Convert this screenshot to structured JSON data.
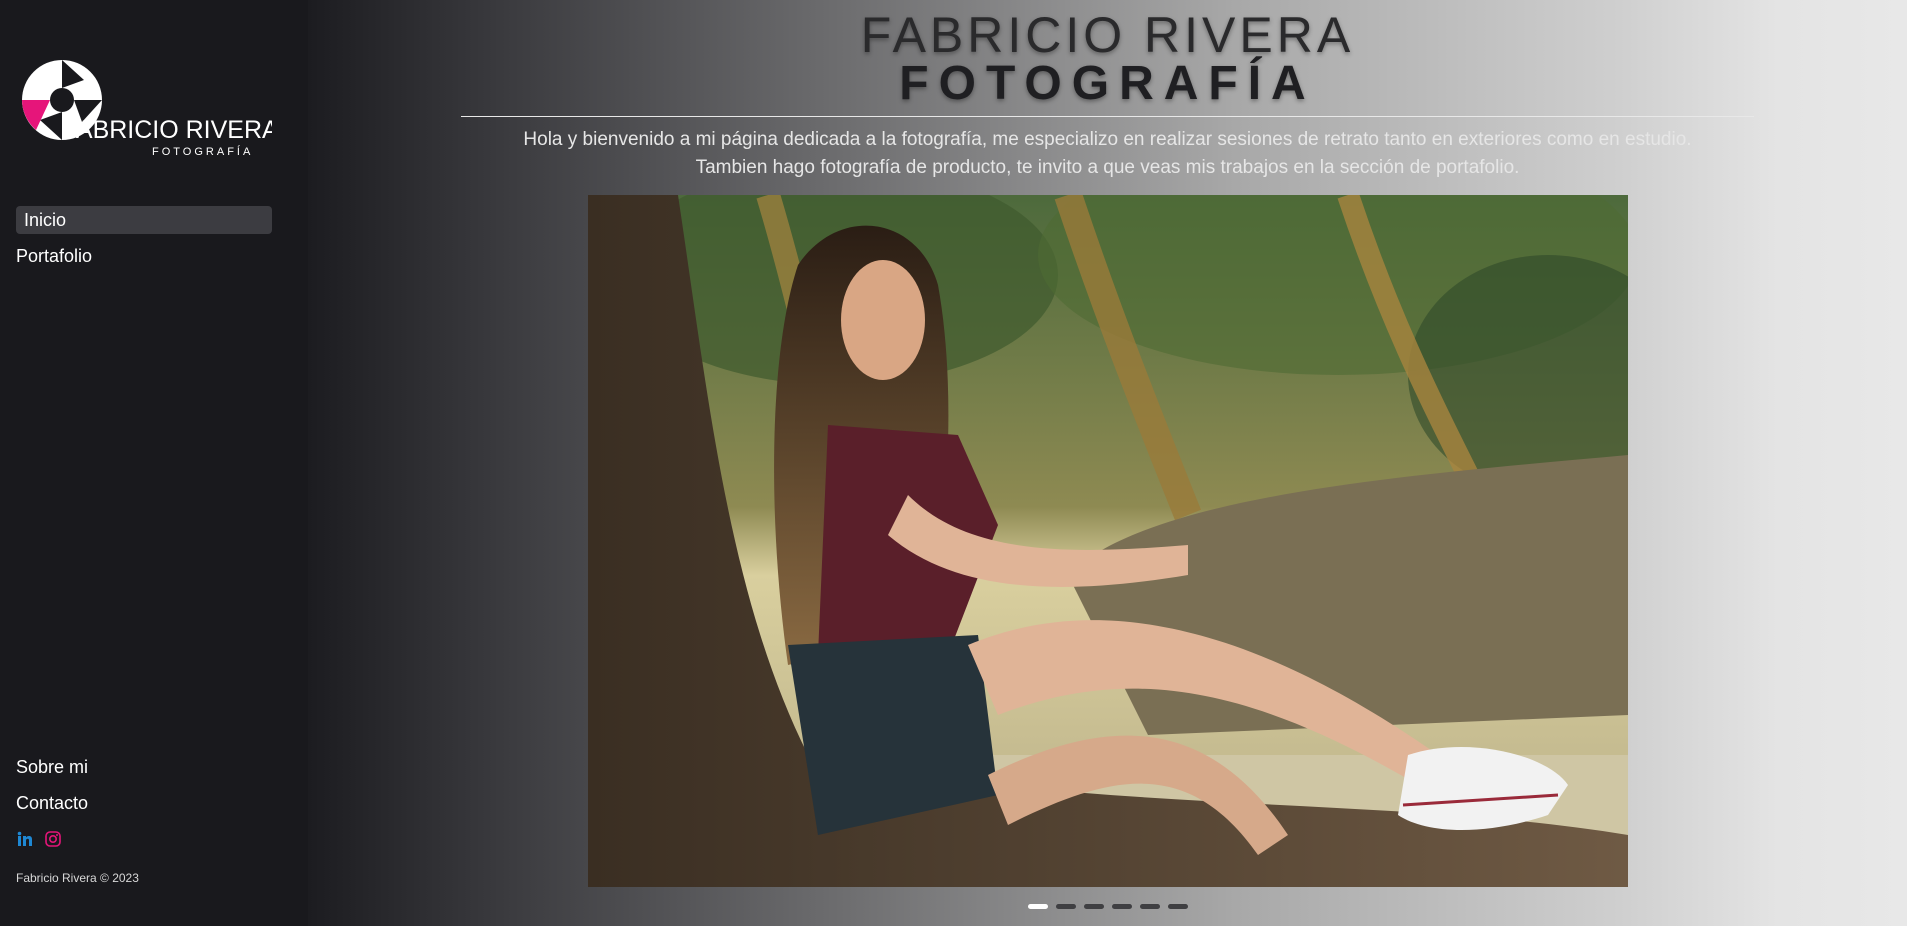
{
  "brand": {
    "name": "FABRICIO RIVERA",
    "tagline": "FOTOGRAFÍA",
    "accent": "#e6157a"
  },
  "sidebar": {
    "nav": [
      {
        "label": "Inicio",
        "active": true
      },
      {
        "label": "Portafolio",
        "active": false
      }
    ],
    "bottom_nav": [
      {
        "label": "Sobre mi"
      },
      {
        "label": "Contacto"
      }
    ],
    "social": [
      {
        "icon": "linkedin-icon",
        "color": "#1e88d4"
      },
      {
        "icon": "instagram-icon",
        "color": "#e6157a"
      }
    ],
    "copyright": "Fabricio Rivera © 2023"
  },
  "main": {
    "title_line1": "FABRICIO RIVERA",
    "title_line2": "FOTOGRAFÍA",
    "intro_line1": "Hola y bienvenido a mi página dedicada a la fotografía, me especializo en realizar sesiones de retrato tanto en exteriores como en estudio.",
    "intro_line2": "Tambien hago fotografía de producto, te invito a que veas mis trabajos en la sección de portafolio.",
    "carousel": {
      "slides": 6,
      "active_index": 0
    }
  }
}
